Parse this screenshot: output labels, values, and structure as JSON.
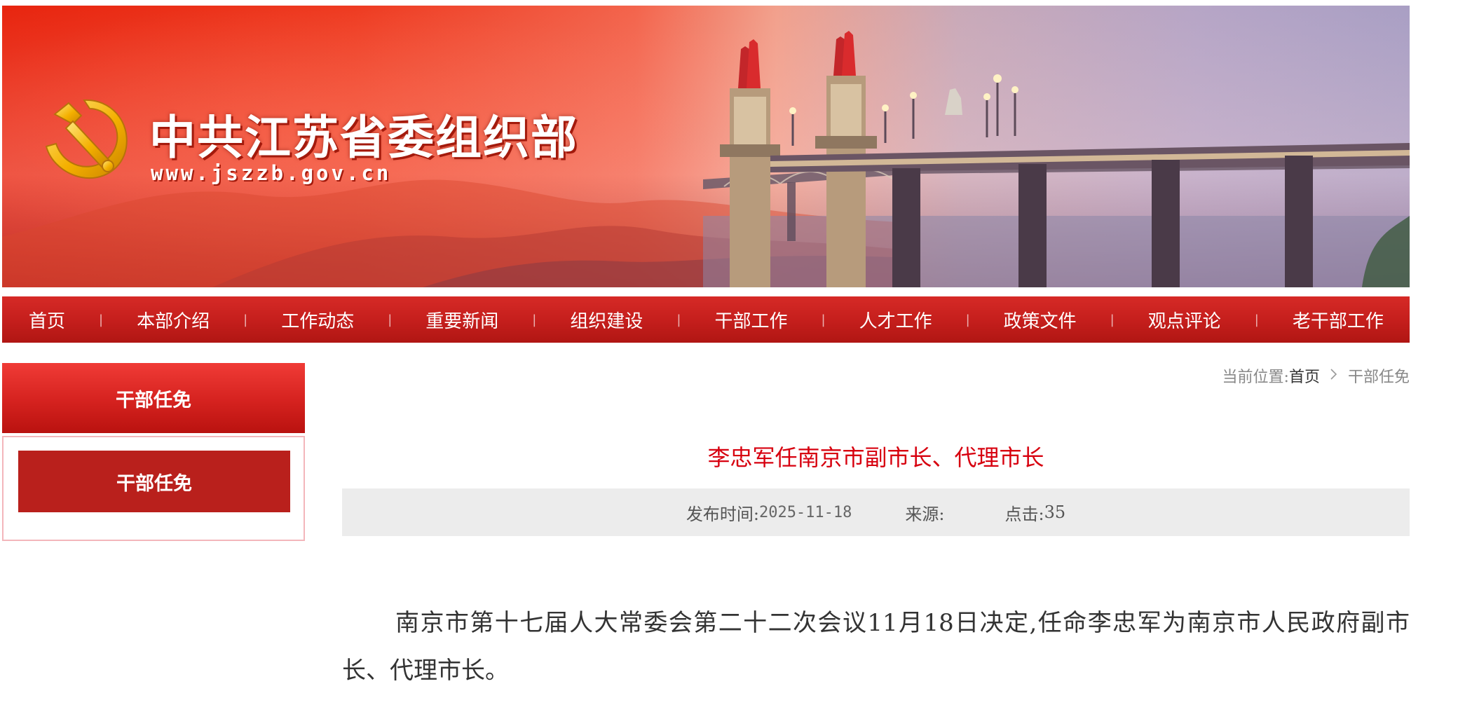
{
  "header": {
    "site_name": "中共江苏省委组织部",
    "site_url": "www.jszzb.gov.cn",
    "emblem_icon": "hammer-sickle-icon",
    "brand_red": "#c41e1c"
  },
  "nav": {
    "items": [
      {
        "label": "首页"
      },
      {
        "label": "本部介绍"
      },
      {
        "label": "工作动态"
      },
      {
        "label": "重要新闻"
      },
      {
        "label": "组织建设"
      },
      {
        "label": "干部工作"
      },
      {
        "label": "人才工作"
      },
      {
        "label": "政策文件"
      },
      {
        "label": "观点评论"
      },
      {
        "label": "老干部工作"
      }
    ],
    "separator": "|"
  },
  "sidebar": {
    "title": "干部任免",
    "links": [
      {
        "label": "干部任免"
      }
    ]
  },
  "breadcrumb": {
    "prefix": "当前位置:",
    "home": "首页",
    "separator_icon": "chevron-right-icon",
    "current": "干部任免"
  },
  "article": {
    "title": "李忠军任南京市副市长、代理市长",
    "meta": {
      "date_label": "发布时间:",
      "date": "2025-11-18",
      "source_label": "来源:",
      "source": "",
      "clicks_label": "点击:",
      "clicks": "35"
    },
    "body": "南京市第十七届人大常委会第二十二次会议11月18日决定,任命李忠军为南京市人民政府副市长、代理市长。",
    "title_color": "#d7000f"
  }
}
